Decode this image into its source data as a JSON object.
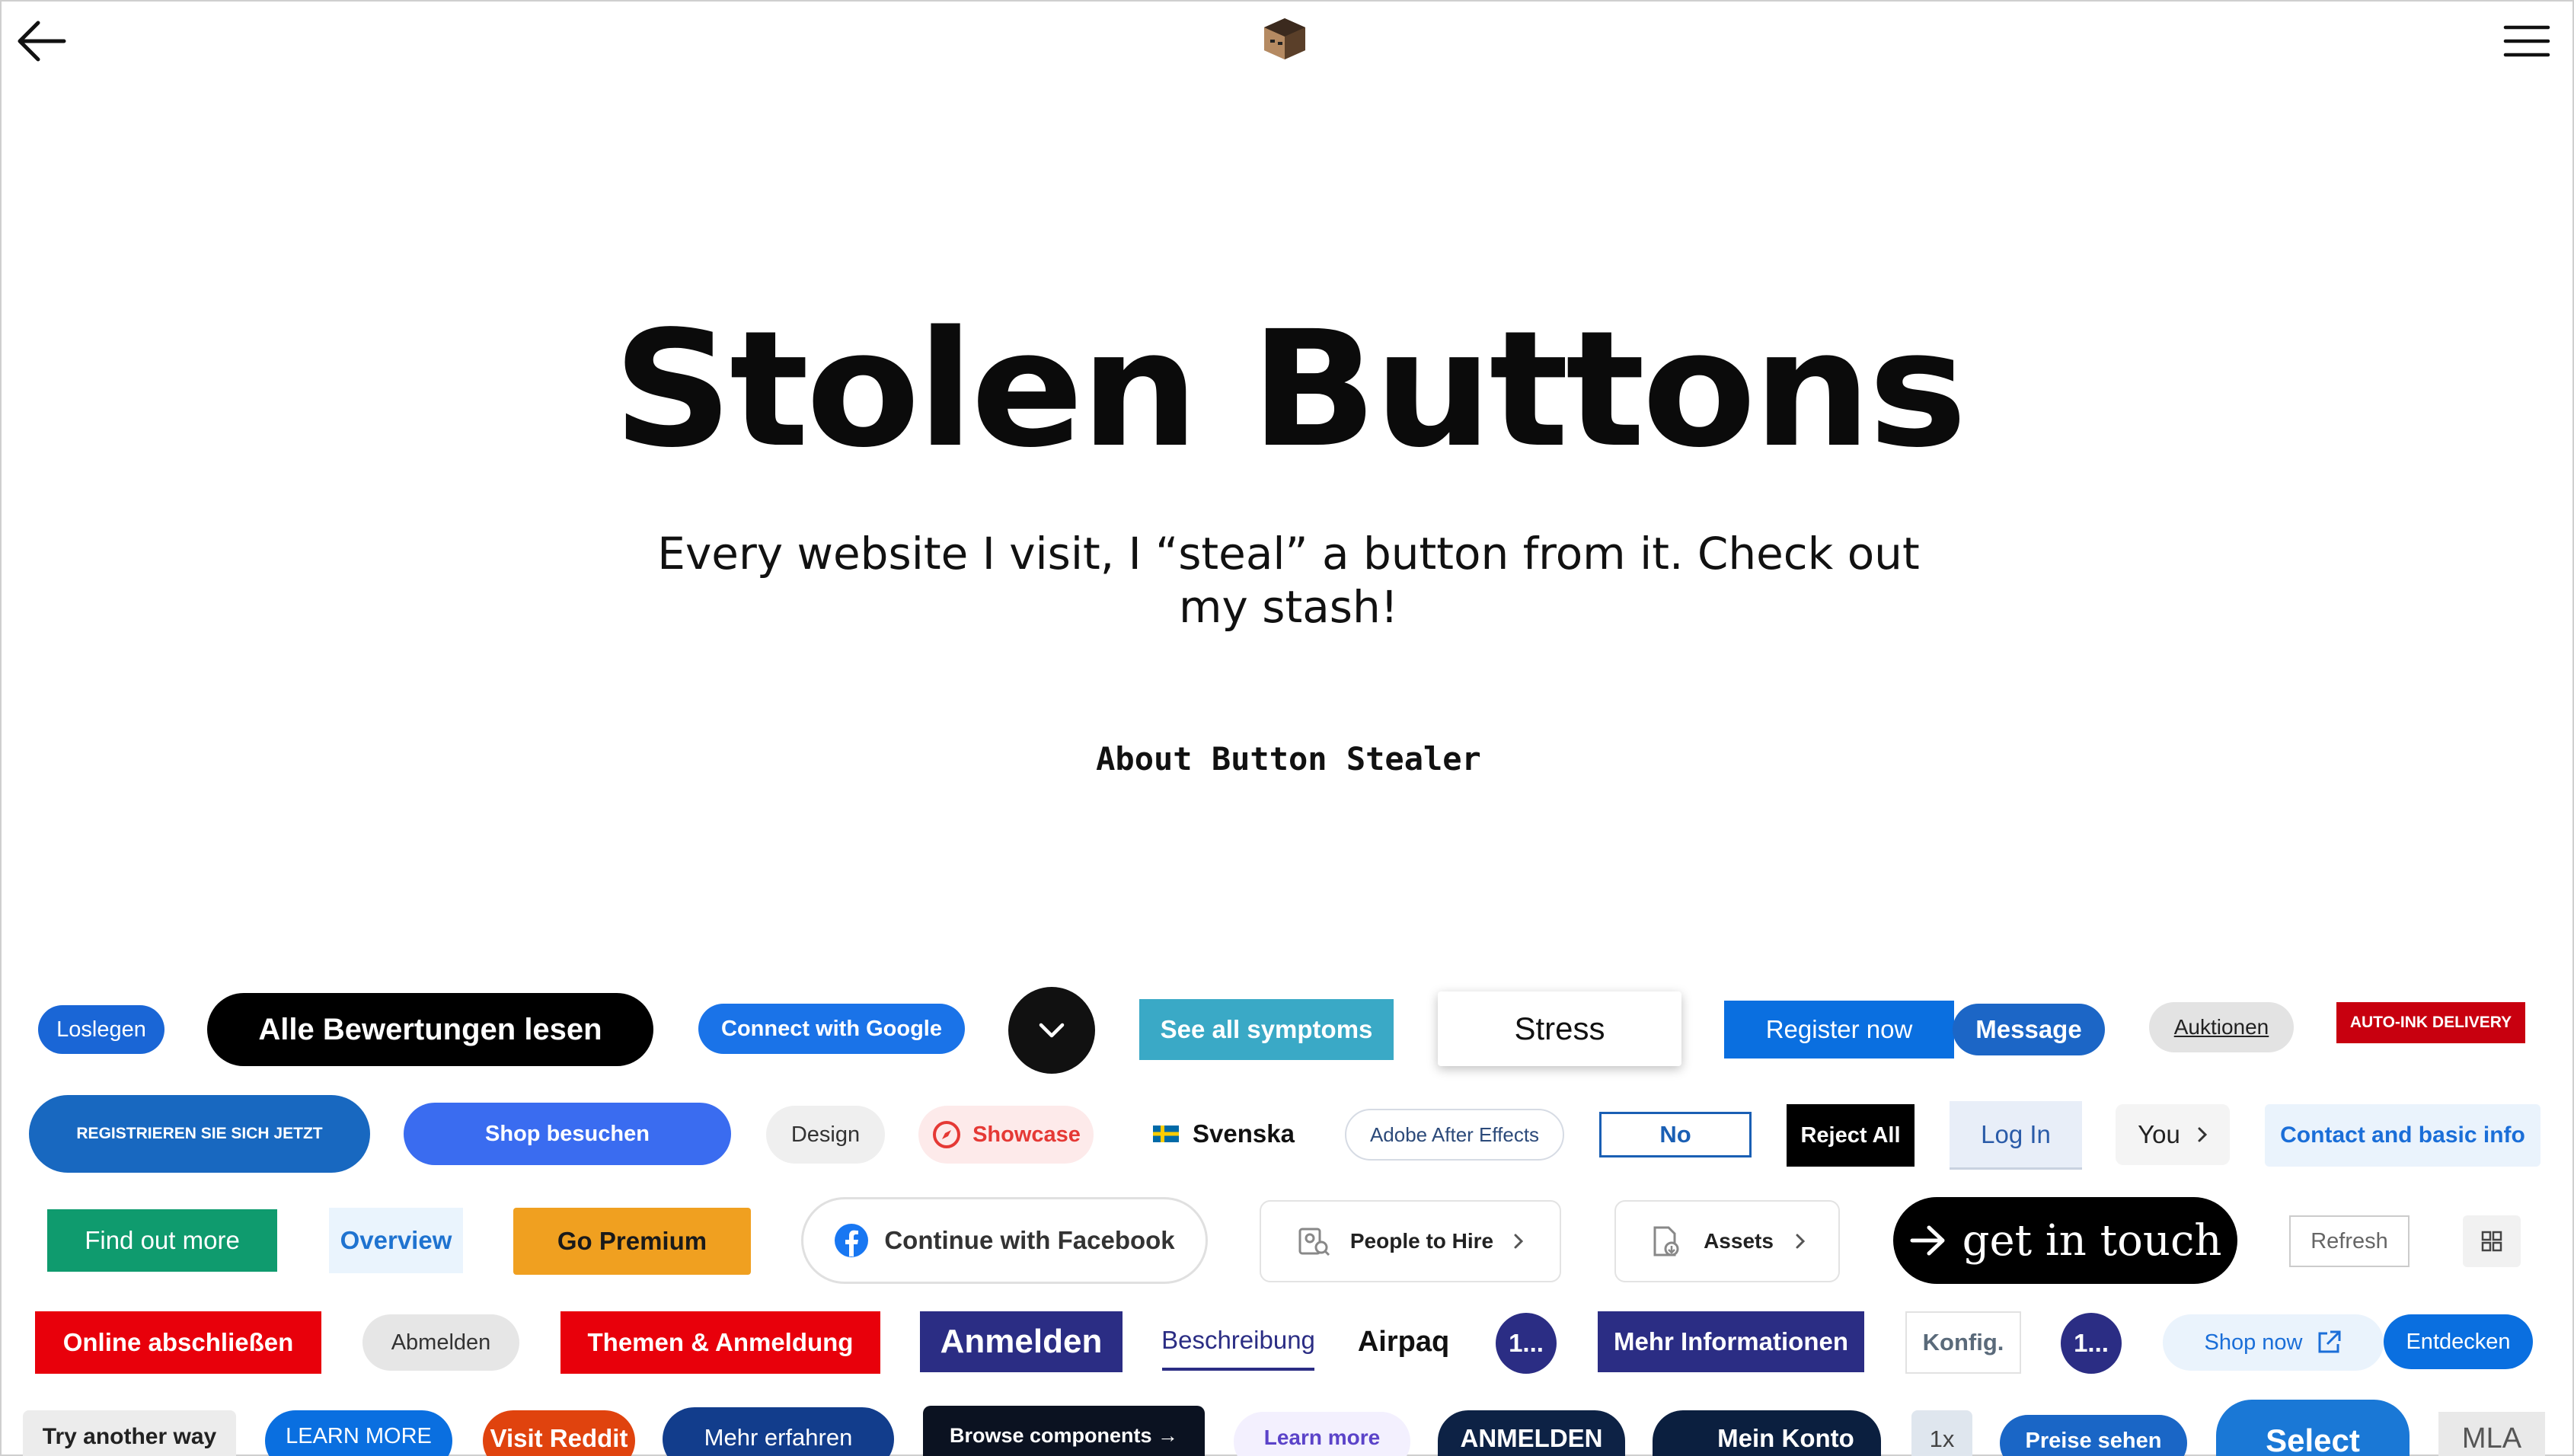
{
  "header": {
    "back_icon": "arrow-left-icon",
    "avatar_icon": "user-avatar",
    "menu_icon": "hamburger-menu-icon"
  },
  "hero": {
    "title": "Stolen Buttons",
    "subtitle": "Every website I visit, I “steal” a button from it. Check out my stash!",
    "about_link": "About Button Stealer"
  },
  "buttons": {
    "row1": [
      "Loslegen",
      "Alle Bewertungen lesen",
      "Connect with Google",
      "",
      "See all symptoms",
      "Stress",
      "Register now",
      "Message",
      "Auktionen",
      "AUTO-INK DELIVERY"
    ],
    "row2": [
      "REGISTRIEREN SIE SICH JETZT",
      "Shop besuchen",
      "Design",
      "Showcase",
      "Svenska",
      "Adobe After Effects",
      "No",
      "Reject All",
      "Log In",
      "You",
      "Contact and basic info"
    ],
    "row3": [
      "Find out more",
      "Overview",
      "Go Premium",
      "Continue with Facebook",
      "People to Hire",
      "Assets",
      "get in touch",
      "Refresh",
      ""
    ],
    "row4": [
      "Online abschließen",
      "Abmelden",
      "Themen & Anmeldung",
      "Anmelden",
      "Beschreibung",
      "Airpaq",
      "1...",
      "Mehr Informationen",
      "Konfig.",
      "1...",
      "Shop now",
      "Entdecken"
    ],
    "row5": [
      "Try another way",
      "LEARN MORE",
      "Visit Reddit",
      "Mehr erfahren",
      "Browse components →",
      "Learn more",
      "ANMELDEN",
      "Mein Konto",
      "1x",
      "Preise sehen",
      "Select",
      "MLA"
    ]
  },
  "colors": {
    "blue": "#1a66d6",
    "black": "#000000",
    "red": "#e8000b",
    "navy": "#2b2d84",
    "teal": "#0f9b6e",
    "amber": "#f0a020"
  }
}
